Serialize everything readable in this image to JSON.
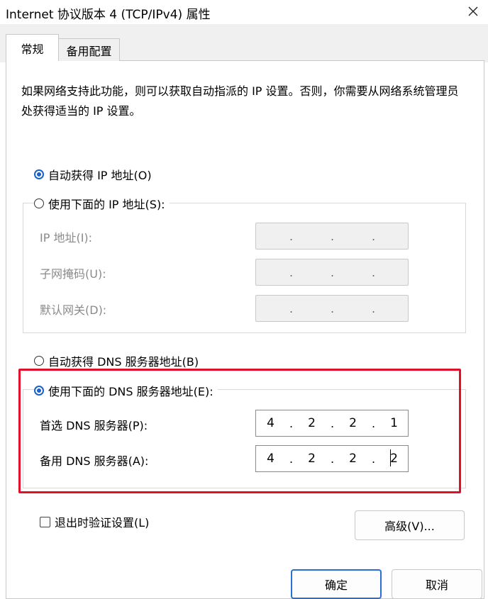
{
  "window": {
    "title": "Internet 协议版本 4 (TCP/IPv4) 属性",
    "close_icon": "close-icon"
  },
  "tabs": [
    {
      "label": "常规",
      "active": true
    },
    {
      "label": "备用配置",
      "active": false
    }
  ],
  "description": "如果网络支持此功能，则可以获取自动指派的 IP 设置。否则，你需要从网络系统管理员处获得适当的 IP 设置。",
  "ip_section": {
    "auto_label": "自动获得 IP 地址(O)",
    "manual_label": "使用下面的 IP 地址(S):",
    "selected": "auto",
    "fields": [
      {
        "label": "IP 地址(I):",
        "octets": [
          "",
          "",
          "",
          ""
        ],
        "enabled": false
      },
      {
        "label": "子网掩码(U):",
        "octets": [
          "",
          "",
          "",
          ""
        ],
        "enabled": false
      },
      {
        "label": "默认网关(D):",
        "octets": [
          "",
          "",
          "",
          ""
        ],
        "enabled": false
      }
    ]
  },
  "dns_section": {
    "auto_label": "自动获得 DNS 服务器地址(B)",
    "manual_label": "使用下面的 DNS 服务器地址(E):",
    "selected": "manual",
    "fields": [
      {
        "label": "首选 DNS 服务器(P):",
        "octets": [
          "4",
          "2",
          "2",
          "1"
        ],
        "enabled": true
      },
      {
        "label": "备用 DNS 服务器(A):",
        "octets": [
          "4",
          "2",
          "2",
          "2"
        ],
        "enabled": true
      }
    ]
  },
  "validate_checkbox": {
    "label": "退出时验证设置(L)",
    "checked": false
  },
  "buttons": {
    "advanced": "高级(V)...",
    "ok": "确定",
    "cancel": "取消"
  },
  "colors": {
    "accent": "#1862c8",
    "highlight": "#e0102a",
    "disabled_field": "#f0f0f0",
    "dim_text": "#8a8a8a"
  }
}
